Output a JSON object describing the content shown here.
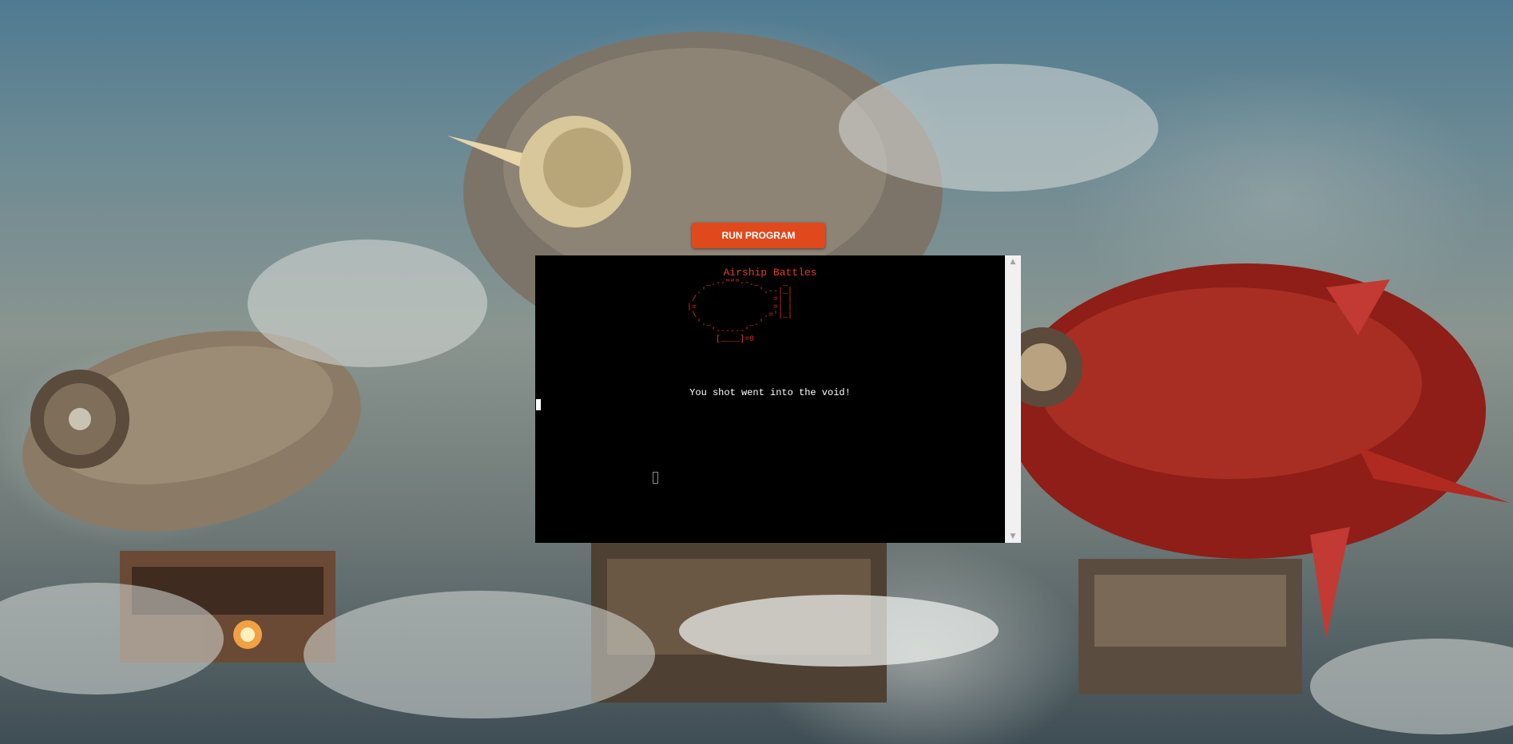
{
  "page": {
    "background": "steampunk-airships-clouds"
  },
  "toolbar": {
    "run_label": "RUN PROGRAM",
    "run_color": "#e0491c"
  },
  "terminal": {
    "title": "Airship Battles",
    "ascii_art": "    _.--\"\"\"--._     _\n  .'           '.--|_|\n /                =| |\n|=                =| |\n \\              .='|_|\n  '._        _.'\n     '------'\n      [____]=0",
    "message": "You shot went into the void!",
    "accent_color": "#d93525",
    "background_color": "#000000"
  },
  "scrollbar": {
    "up_icon": "▲",
    "down_icon": "▼"
  }
}
